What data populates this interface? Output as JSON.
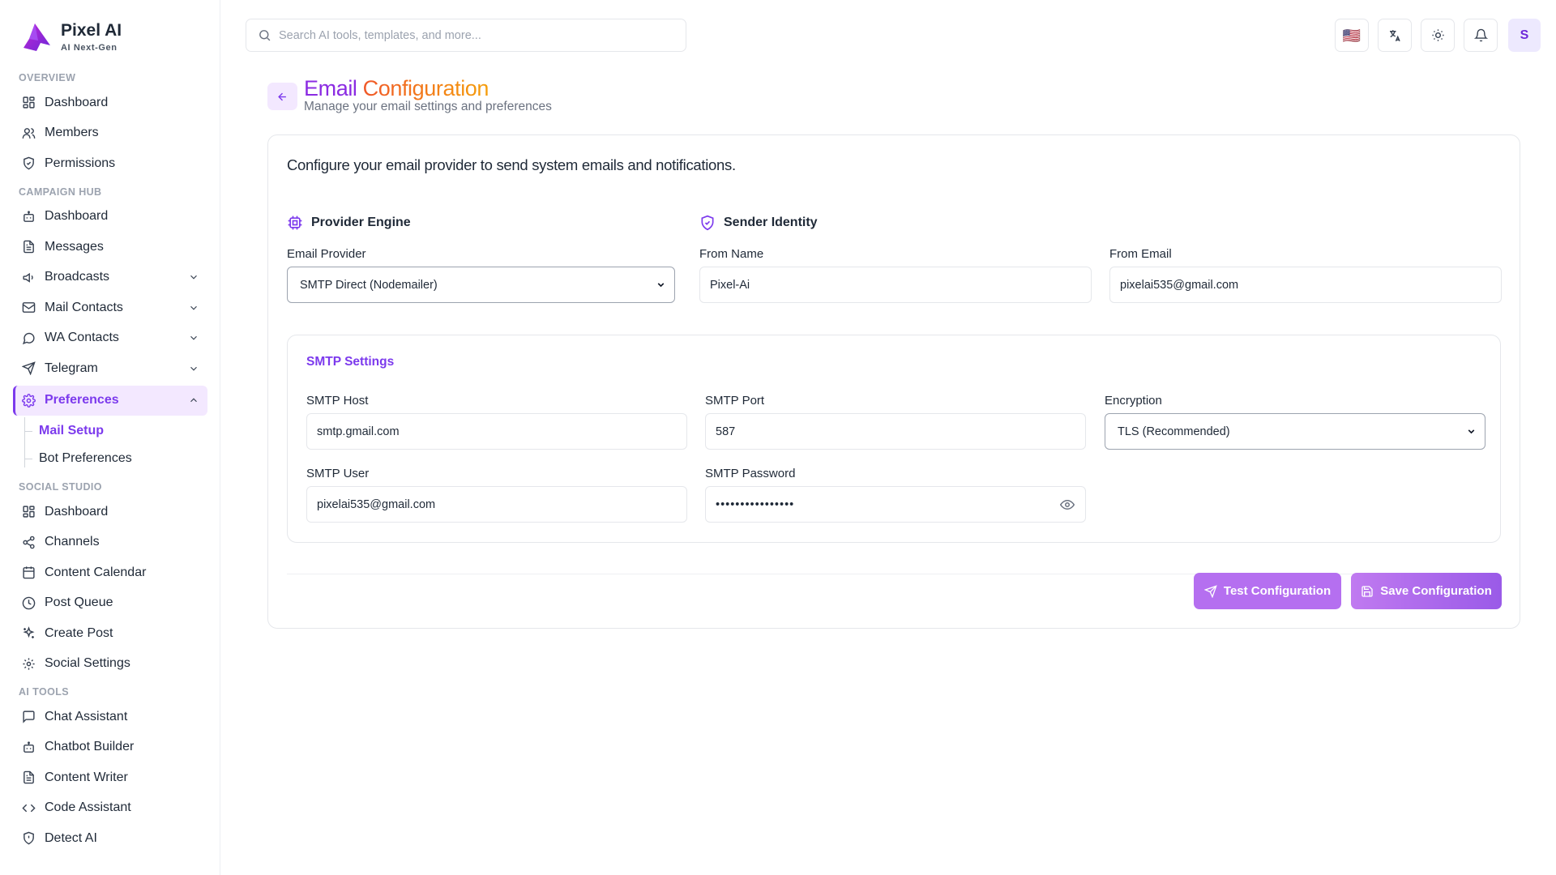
{
  "app": {
    "name": "Pixel AI",
    "tagline": "AI Next-Gen"
  },
  "search": {
    "placeholder": "Search AI tools, templates, and more..."
  },
  "topbar": {
    "flag": "🇺🇸",
    "avatar_initial": "S"
  },
  "sidebar": {
    "overview": {
      "label": "OVERVIEW",
      "items": [
        {
          "label": "Dashboard"
        },
        {
          "label": "Members"
        },
        {
          "label": "Permissions"
        }
      ]
    },
    "campaign": {
      "label": "CAMPAIGN HUB",
      "items": [
        {
          "label": "Dashboard"
        },
        {
          "label": "Messages"
        },
        {
          "label": "Broadcasts"
        },
        {
          "label": "Mail Contacts"
        },
        {
          "label": "WA Contacts"
        },
        {
          "label": "Telegram"
        },
        {
          "label": "Preferences"
        }
      ],
      "sub_items": [
        {
          "label": "Mail Setup"
        },
        {
          "label": "Bot Preferences"
        }
      ]
    },
    "social": {
      "label": "SOCIAL STUDIO",
      "items": [
        {
          "label": "Dashboard"
        },
        {
          "label": "Channels"
        },
        {
          "label": "Content Calendar"
        },
        {
          "label": "Post Queue"
        },
        {
          "label": "Create Post"
        },
        {
          "label": "Social Settings"
        }
      ]
    },
    "ai_tools": {
      "label": "AI TOOLS",
      "items": [
        {
          "label": "Chat Assistant"
        },
        {
          "label": "Chatbot Builder"
        },
        {
          "label": "Content Writer"
        },
        {
          "label": "Code Assistant"
        },
        {
          "label": "Detect AI"
        }
      ]
    }
  },
  "page": {
    "title_part1": "Email",
    "title_part2": " Configuration",
    "subtitle": "Manage your email settings and preferences",
    "description": "Configure your email provider to send system emails and notifications."
  },
  "provider": {
    "heading": "Provider Engine",
    "provider_label": "Email Provider",
    "provider_value": "SMTP Direct (Nodemailer)"
  },
  "sender": {
    "heading": "Sender Identity",
    "from_name_label": "From Name",
    "from_name_value": "Pixel-Ai",
    "from_email_label": "From Email",
    "from_email_value": "pixelai535@gmail.com"
  },
  "smtp": {
    "heading": "SMTP Settings",
    "host_label": "SMTP Host",
    "host_value": "smtp.gmail.com",
    "port_label": "SMTP Port",
    "port_value": "587",
    "encryption_label": "Encryption",
    "encryption_value": "TLS (Recommended)",
    "user_label": "SMTP User",
    "user_value": "pixelai535@gmail.com",
    "password_label": "SMTP Password",
    "password_value": "••••••••••••••••"
  },
  "actions": {
    "test_label": "Test Configuration",
    "save_label": "Save Configuration"
  },
  "colors": {
    "accent": "#7c3aed",
    "title_purple": "#8b2be2",
    "title_orange": "#f0552a",
    "active_bg": "#f3e8ff"
  }
}
